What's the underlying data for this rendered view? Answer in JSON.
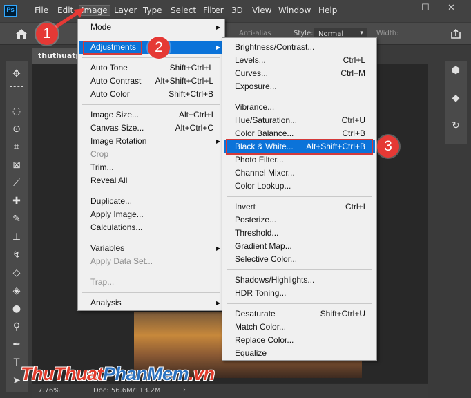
{
  "app": {
    "logo": "Ps"
  },
  "menubar": {
    "items": [
      "File",
      "Edit",
      "Image",
      "Layer",
      "Type",
      "Select",
      "Filter",
      "3D",
      "View",
      "Window",
      "Help"
    ],
    "active": "Image"
  },
  "window_controls": {
    "minimize": "—",
    "maximize": "☐",
    "close": "✕"
  },
  "options_bar": {
    "anti_alias": "Anti-alias",
    "style_label": "Style:",
    "style_value": "Normal",
    "width_label": "Width:"
  },
  "document": {
    "tab_title": "thuthuatpl",
    "zoom": "7.76%",
    "doc_size": "Doc: 56.6M/113.2M"
  },
  "image_menu": [
    {
      "label": "Mode",
      "submenu": true
    },
    {
      "label": "Adjustments",
      "submenu": true,
      "highlighted": true
    },
    {
      "label": "Auto Tone",
      "shortcut": "Shift+Ctrl+L"
    },
    {
      "label": "Auto Contrast",
      "shortcut": "Alt+Shift+Ctrl+L"
    },
    {
      "label": "Auto Color",
      "shortcut": "Shift+Ctrl+B"
    },
    {
      "label": "Image Size...",
      "shortcut": "Alt+Ctrl+I"
    },
    {
      "label": "Canvas Size...",
      "shortcut": "Alt+Ctrl+C"
    },
    {
      "label": "Image Rotation",
      "submenu": true
    },
    {
      "label": "Crop",
      "disabled": true
    },
    {
      "label": "Trim..."
    },
    {
      "label": "Reveal All"
    },
    {
      "label": "Duplicate..."
    },
    {
      "label": "Apply Image..."
    },
    {
      "label": "Calculations..."
    },
    {
      "label": "Variables",
      "submenu": true
    },
    {
      "label": "Apply Data Set...",
      "disabled": true
    },
    {
      "label": "Trap...",
      "disabled": true
    },
    {
      "label": "Analysis",
      "submenu": true
    }
  ],
  "adjustments_menu": [
    {
      "label": "Brightness/Contrast..."
    },
    {
      "label": "Levels...",
      "shortcut": "Ctrl+L"
    },
    {
      "label": "Curves...",
      "shortcut": "Ctrl+M"
    },
    {
      "label": "Exposure..."
    },
    {
      "label": "Vibrance..."
    },
    {
      "label": "Hue/Saturation...",
      "shortcut": "Ctrl+U"
    },
    {
      "label": "Color Balance...",
      "shortcut": "Ctrl+B"
    },
    {
      "label": "Black & White...",
      "shortcut": "Alt+Shift+Ctrl+B",
      "highlighted": true
    },
    {
      "label": "Photo Filter..."
    },
    {
      "label": "Channel Mixer..."
    },
    {
      "label": "Color Lookup..."
    },
    {
      "label": "Invert",
      "shortcut": "Ctrl+I"
    },
    {
      "label": "Posterize..."
    },
    {
      "label": "Threshold..."
    },
    {
      "label": "Gradient Map..."
    },
    {
      "label": "Selective Color..."
    },
    {
      "label": "Shadows/Highlights..."
    },
    {
      "label": "HDR Toning..."
    },
    {
      "label": "Desaturate",
      "shortcut": "Shift+Ctrl+U"
    },
    {
      "label": "Match Color..."
    },
    {
      "label": "Replace Color..."
    },
    {
      "label": "Equalize"
    }
  ],
  "callouts": [
    "1",
    "2",
    "3"
  ],
  "watermark": {
    "part1": "ThuThuat",
    "part2": "PhanMem",
    "part3": ".vn"
  },
  "colors": {
    "highlight": "#0b73d9",
    "callout": "#e53935",
    "annotation_box": "#d43a3a"
  }
}
